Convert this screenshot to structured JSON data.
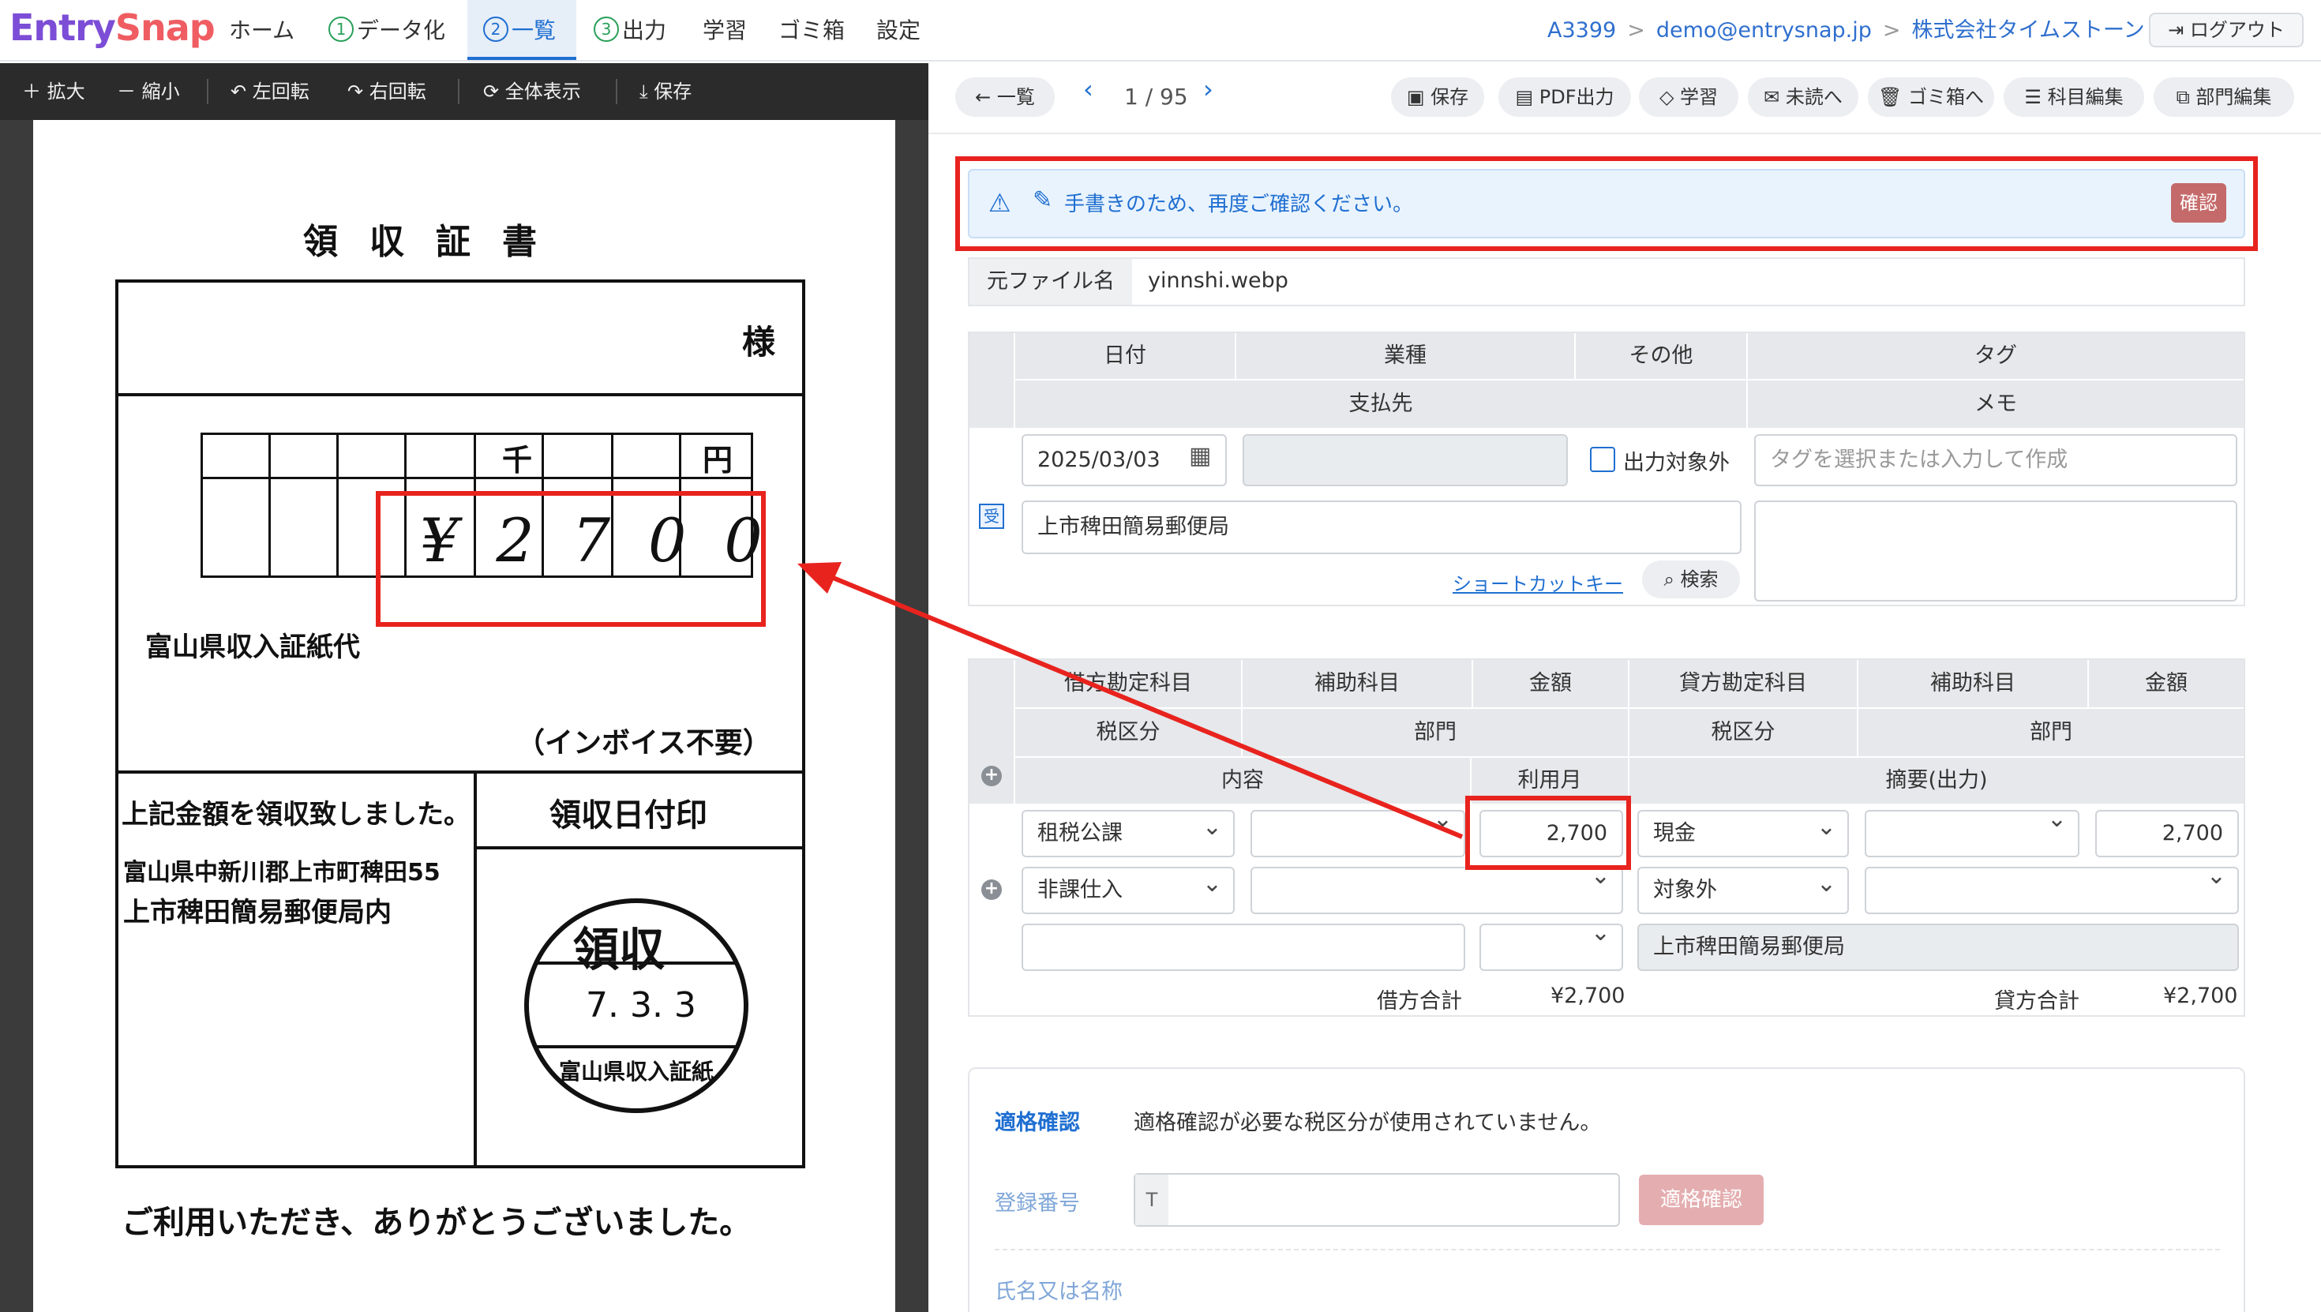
{
  "app": {
    "logo_a": "Entry",
    "logo_b": "Snap"
  },
  "nav": {
    "home": "ホーム",
    "datafy_num": "1",
    "datafy": "データ化",
    "list_num": "2",
    "list": "一覧",
    "output_num": "3",
    "output": "出力",
    "learn": "学習",
    "trash": "ゴミ箱",
    "settings": "設定"
  },
  "breadcrumb": {
    "account": "A3399",
    "email": "demo@entrysnap.jp",
    "company": "株式会社タイムストーン",
    "sep": ">"
  },
  "logout_label": "ログアウト",
  "viewer_toolbar": {
    "zoom_in": "＋ 拡大",
    "zoom_out": "－ 縮小",
    "rotate_left": "↶ 左回転",
    "rotate_right": "↷ 右回転",
    "fit": "⟳ 全体表示",
    "save": "⤓ 保存"
  },
  "receipt": {
    "title": "領収証書",
    "sama": "様",
    "thousand": "千",
    "yen": "円",
    "amount_handwritten": "¥2700",
    "item": "富山県収入証紙代",
    "invoice_note": "（インボイス不要）",
    "received_text": "上記金額を領収致しました。",
    "stamp_header": "領収日付印",
    "address": "富山県中新川郡上市町稗田55",
    "office": "上市稗田簡易郵便局内",
    "stamp_main": "領収",
    "stamp_date": "7. 3. 3",
    "stamp_bottom": "富山県収入証紙",
    "thanks": "ご利用いただき、ありがとうございました。"
  },
  "doc_toolbar": {
    "back": "← 一覧",
    "page": "1 / 95",
    "save": "保存",
    "pdf": "PDF出力",
    "learn": "学習",
    "unread": "未読へ",
    "trash": "ゴミ箱へ",
    "accounts": "科目編集",
    "departments": "部門編集"
  },
  "alert": {
    "message": "手書きのため、再度ご確認ください。",
    "confirm": "確認"
  },
  "file": {
    "label": "元ファイル名",
    "name": "yinnshi.webp"
  },
  "header_fields": {
    "date": "日付",
    "industry": "業種",
    "other": "その他",
    "tag": "タグ",
    "payee": "支払先",
    "memo": "メモ",
    "date_value": "2025/03/03",
    "exclude_label": "出力対象外",
    "tag_placeholder": "タグを選択または入力して作成",
    "receipt_badge": "受",
    "payee_value": "上市稗田簡易郵便局",
    "shortcut": "ショートカットキー",
    "search": "検索"
  },
  "journal": {
    "debit_account": "借方勘定科目",
    "sub_account": "補助科目",
    "amount": "金額",
    "credit_account": "貸方勘定科目",
    "credit_sub": "補助科目",
    "credit_amount": "金額",
    "tax": "税区分",
    "dept": "部門",
    "credit_tax": "税区分",
    "credit_dept": "部門",
    "content": "内容",
    "month": "利用月",
    "summary": "摘要(出力)",
    "row": {
      "debit_account": "租税公課",
      "debit_amount": "2,700",
      "credit_account": "現金",
      "credit_amount": "2,700",
      "debit_tax": "非課仕入",
      "credit_tax": "対象外",
      "summary": "上市稗田簡易郵便局"
    },
    "debit_total_label": "借方合計",
    "debit_total": "¥2,700",
    "credit_total_label": "貸方合計",
    "credit_total": "¥2,700"
  },
  "qualification": {
    "title": "適格確認",
    "message": "適格確認が必要な税区分が使用されていません。",
    "reg_label": "登録番号",
    "reg_prefix": "T",
    "check_button": "適格確認",
    "name_label": "氏名又は名称"
  },
  "colors": {
    "accent": "#1f6fd1",
    "annotation": "#e8231e",
    "logo_purple": "#7c4dd6",
    "logo_red": "#ef5d62"
  }
}
